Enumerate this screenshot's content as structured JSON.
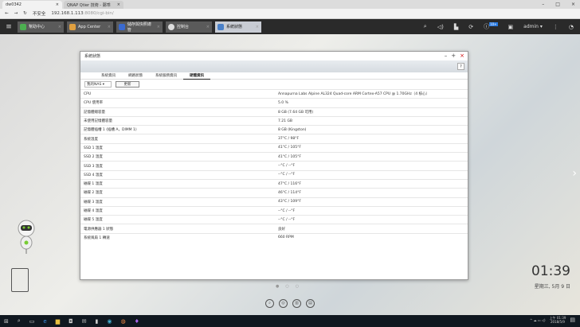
{
  "browser": {
    "tabs": [
      {
        "label": "dw0342"
      },
      {
        "label": "QNAP Qtier 技術 - 鄭乖"
      }
    ],
    "address_prefix": "不安全",
    "address_host": "192.168.1.113",
    "address_rest": ":8080/cgi-bin/"
  },
  "qts": {
    "apps": [
      {
        "label": "幫助中心",
        "color": "#4caf50"
      },
      {
        "label": "App Center",
        "color": "#e0a040"
      },
      {
        "label": "儲存與快照總管",
        "color": "#3a6ad0"
      },
      {
        "label": "控制台",
        "color": "#888888"
      },
      {
        "label": "系統狀態",
        "color": "#4a80c8"
      }
    ],
    "user": "admin",
    "notification_badge": "10+"
  },
  "window": {
    "title": "系統狀態",
    "tabs": [
      "系統資訊",
      "網路狀態",
      "系統服務資訊",
      "硬體資訊"
    ],
    "active_tab": 3,
    "select_value": "我的NAS",
    "refresh_label": "更新",
    "rows": [
      {
        "k": "CPU",
        "v": "Annapurna Labs Alpine AL324 Quad-core ARM Cortex-A57 CPU @ 1.70GHz（4 核心）"
      },
      {
        "k": "CPU 使用率",
        "v": "5.0 %"
      },
      {
        "k": "記憶體總容量",
        "v": "8 GB (7.64 GB 可用)"
      },
      {
        "k": "未使用記憶體容量",
        "v": "7.21 GB"
      },
      {
        "k": "記憶體插槽 1 (插槽 A，DIMM 1)",
        "v": "8 GB (Kingston)"
      },
      {
        "k": "系統溫度",
        "v": "37°C / 98°F"
      },
      {
        "k": "SSD 1 溫度",
        "v": "41°C / 105°F"
      },
      {
        "k": "SSD 2 溫度",
        "v": "41°C / 105°F"
      },
      {
        "k": "SSD 3 溫度",
        "v": "--°C / --°F"
      },
      {
        "k": "SSD 4 溫度",
        "v": "--°C / --°F"
      },
      {
        "k": "磁碟 1 溫度",
        "v": "47°C / 116°F"
      },
      {
        "k": "磁碟 2 溫度",
        "v": "46°C / 114°F"
      },
      {
        "k": "磁碟 3 溫度",
        "v": "43°C / 109°F"
      },
      {
        "k": "磁碟 4 溫度",
        "v": "--°C / --°F"
      },
      {
        "k": "磁碟 5 溫度",
        "v": "--°C / --°F"
      },
      {
        "k": "電源供應器 1 狀態",
        "v": "良好"
      },
      {
        "k": "系統風扇 1 轉速",
        "v": "660 RPM"
      }
    ]
  },
  "desktop": {
    "time": "01:39",
    "date": "星期三, 5月 9 日"
  },
  "taskbar": {
    "time": "上午 01:39",
    "date": "2018/5/9"
  }
}
